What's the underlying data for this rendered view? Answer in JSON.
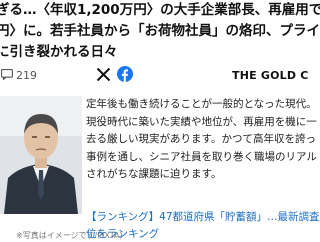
{
  "article": {
    "headline_lines": [
      "ぎる…〈年収1,200万円〉の大手企業部長、再雇用で",
      "円〉に。若手社員から「お荷物社員」の烙印、プライド",
      "に引き裂かれる日々"
    ],
    "comment_count": "219",
    "source_name": "THE GOLD C",
    "summary_lines": [
      "定年後も働き続けることが一般的となった現代。",
      "現役時代に築いた実績や地位が、再雇用を機に一",
      "去る厳しい現実があります。かつて高年収を誇っ",
      "事例を通し、シニア社員を取り巻く職場のリアル",
      "されがちな課題に迫ります。"
    ],
    "photo_credit": "※写真はイメージです/PIXTA)",
    "related_link_lines": [
      "【ランキング】47都道府県「貯蓄額」…最新調査",
      "位をランキング"
    ]
  },
  "colors": {
    "link": "#1a6fc4",
    "facebook": "#1877f2"
  },
  "icons": [
    "comment-icon",
    "x-twitter-icon",
    "facebook-icon"
  ]
}
